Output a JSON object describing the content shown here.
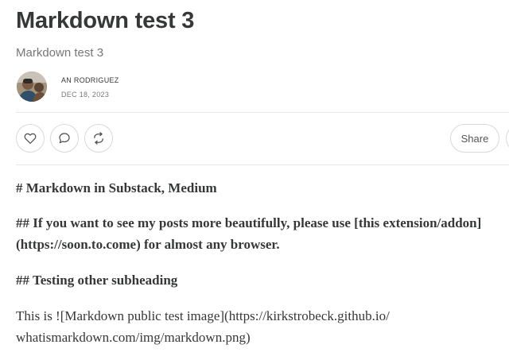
{
  "post": {
    "title": "Markdown test 3",
    "subtitle": "Markdown test 3",
    "author": "AN RODRIGUEZ",
    "date": "DEC 18, 2023"
  },
  "actions": {
    "like_icon": "heart-icon",
    "comment_icon": "comment-icon",
    "restack_icon": "restack-icon",
    "share_label": "Share"
  },
  "content": {
    "p1": "# Markdown in Substack, Medium",
    "p2_line1": "## If you want to see my posts more beautifully, please use [this extension/addon]",
    "p2_line2": "(https://soon.to.come) for almost any browser.",
    "p3": "## Testing other subheading",
    "p4_line1": "This is ![Markdown public test image](https://kirkstrobeck.github.io/",
    "p4_line2": "whatismarkdown.com/img/markdown.png)"
  }
}
